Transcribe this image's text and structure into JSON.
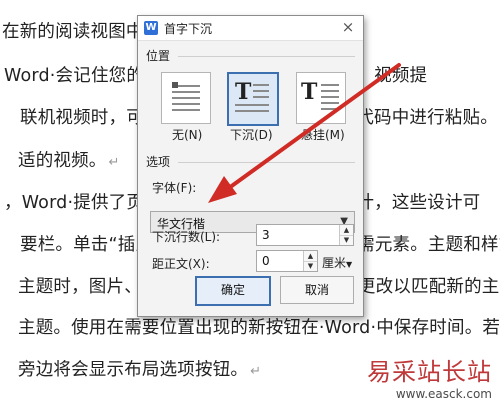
{
  "document": {
    "lines": [
      {
        "text": "在新的阅读视图中可以折叠文档某些部分并关",
        "mark": false
      },
      {
        "text": "Word·会记住您的位置，即使在另一个设备上。视频提",
        "mark": false
      },
      {
        "text": "联机视频时，可以在想要添加的视频的嵌入代码中进行粘贴。",
        "mark": false
      },
      {
        "text": "适的视频。",
        "mark": true
      },
      {
        "text": "，Word·提供了页眉、页脚、封面和文本框设计，这些设计可",
        "mark": false
      },
      {
        "text": "要栏。单击“插入”，然后从不同库中选择所需元素。主题和样式",
        "mark": false
      },
      {
        "text": "主题时，图片、图表或·SmartArt·图形将会更改以匹配新的主题",
        "mark": false
      },
      {
        "text": "主题。使用在需要位置出现的新按钮在·Word·中保存时间。若",
        "mark": false
      },
      {
        "text": "旁边将会显示布局选项按钮。",
        "mark": true
      }
    ],
    "para_mark": "↵"
  },
  "dialog": {
    "app_icon": "W",
    "title": "首字下沉",
    "close_icon": "×",
    "position_section": "位置",
    "positions": [
      {
        "label": "无(N)",
        "icon": "none-icon",
        "selected": false
      },
      {
        "label": "下沉(D)",
        "icon": "drop-icon",
        "selected": true
      },
      {
        "label": "悬挂(M)",
        "icon": "margin-icon",
        "selected": false
      }
    ],
    "options_section": "选项",
    "font_label": "字体(F):",
    "font_value": "华文行楷",
    "lines_label": "下沉行数(L):",
    "lines_value": "3",
    "distance_label": "距正文(X):",
    "distance_value": "0",
    "distance_unit": "厘米",
    "ok_label": "确定",
    "cancel_label": "取消"
  },
  "watermark": {
    "main": "易采站长站",
    "sub": "www.easck.com"
  },
  "colors": {
    "accent": "#3b6fb0",
    "arrow": "#d02b25",
    "watermark": "#c0393a"
  }
}
